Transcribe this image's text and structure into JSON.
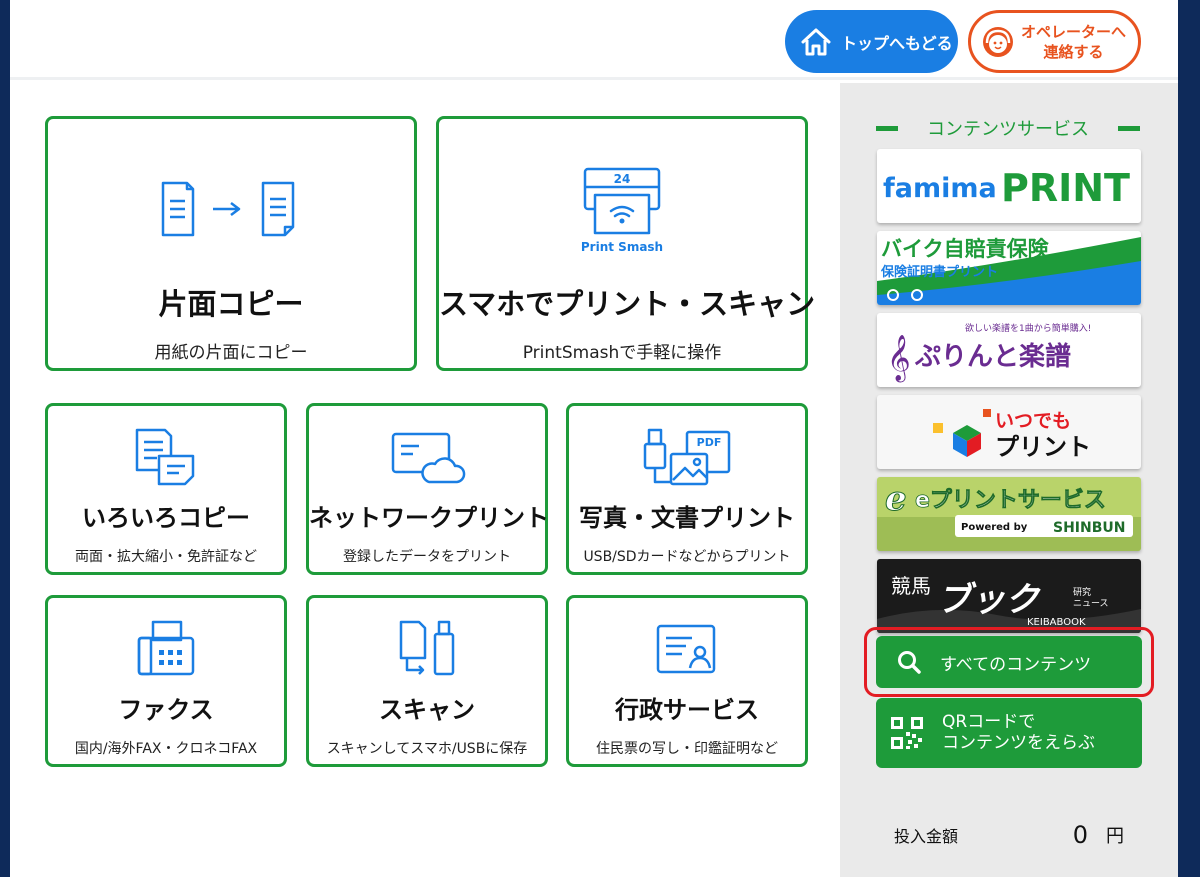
{
  "header": {
    "top_button": "トップへもどる",
    "operator_button": "オペレーターへ\n連絡する"
  },
  "colors": {
    "green": "#1e9b3a",
    "blue": "#1a7ee3",
    "orange": "#e8531f",
    "red": "#e31c23"
  },
  "cards": [
    {
      "title": "片面コピー",
      "sub": "用紙の片面にコピー",
      "icon": "copy-arrow-icon"
    },
    {
      "title": "スマホでプリント・スキャン",
      "sub": "PrintSmashで手軽に操作",
      "icon": "printsmash-icon",
      "icon_text": "Print Smash",
      "icon_num": "24"
    },
    {
      "title": "いろいろコピー",
      "sub": "両面・拡大縮小・免許証など",
      "icon": "documents-icon"
    },
    {
      "title": "ネットワークプリント",
      "sub": "登録したデータをプリント",
      "icon": "cloud-doc-icon"
    },
    {
      "title": "写真・文書プリント",
      "sub": "USB/SDカードなどからプリント",
      "icon": "usb-photo-pdf-icon",
      "icon_text": "PDF"
    },
    {
      "title": "ファクス",
      "sub": "国内/海外FAX・クロネコFAX",
      "icon": "fax-icon"
    },
    {
      "title": "スキャン",
      "sub": "スキャンしてスマホ/USBに保存",
      "icon": "scan-icon"
    },
    {
      "title": "行政サービス",
      "sub": "住民票の写し・印鑑証明など",
      "icon": "resident-card-icon"
    }
  ],
  "sidebar": {
    "heading": "コンテンツサービス",
    "banners": [
      {
        "name": "famima PRINT",
        "text1": "famima",
        "text2": "PRINT"
      },
      {
        "name": "バイク自賠責保険",
        "text1": "バイク自賠責保険",
        "text2": "保険証明書プリント"
      },
      {
        "name": "ぷりんと楽譜",
        "text1": "欲しい楽譜を1曲から簡単購入!",
        "text2": "ぷりんと楽譜"
      },
      {
        "name": "いつでもプリント",
        "text1": "いつでも",
        "text2": "プリント"
      },
      {
        "name": "eプリントサービス",
        "text1": "eプリントサービス",
        "text2": "Powered by",
        "text3": "SHINBUN"
      },
      {
        "name": "競馬ブック",
        "text1": "競馬",
        "text2": "ブック",
        "text3": "KEIBABOOK",
        "text4": "研究\nニュース"
      }
    ],
    "all_contents": "すべてのコンテンツ",
    "qr_button": "QRコードで\nコンテンツをえらぶ",
    "money_label": "投入金額",
    "money_value": "0",
    "money_unit": "円"
  }
}
